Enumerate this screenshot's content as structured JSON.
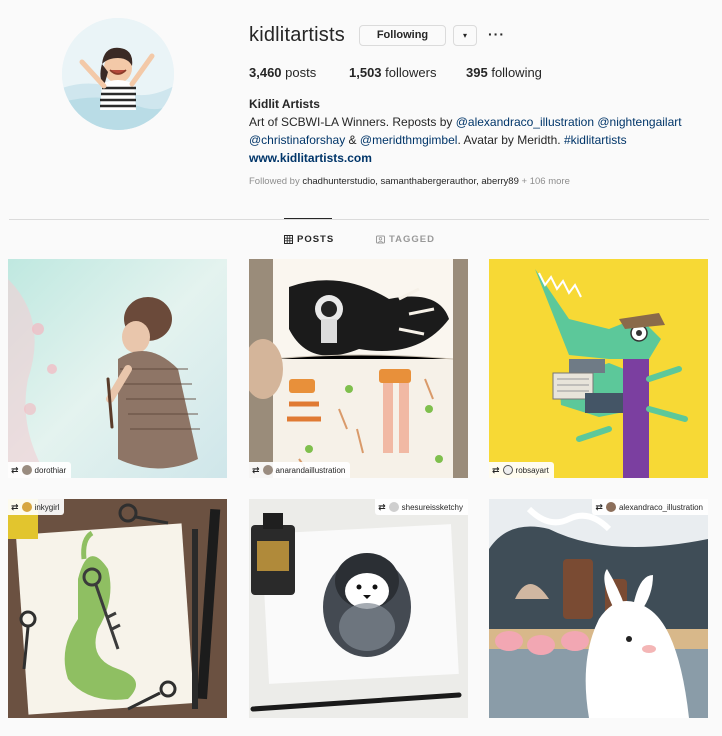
{
  "profile": {
    "username": "kidlitartists",
    "follow_label": "Following",
    "dropdown_glyph": "▾",
    "more_glyph": "···",
    "stats": {
      "posts_count": "3,460",
      "posts_label": "posts",
      "followers_count": "1,503",
      "followers_label": "followers",
      "following_count": "395",
      "following_label": "following"
    },
    "bio": {
      "name": "Kidlit Artists",
      "text_1": "Art of SCBWI-LA Winners. Reposts by ",
      "mention_1": "@alexandraco_illustration",
      "mention_2": "@nightengailart",
      "mention_3": "@christinaforshay",
      "text_2": " & ",
      "mention_4": "@meridthmgimbel",
      "text_3": ". Avatar by Meridth. ",
      "hashtag": "#kidlitartists",
      "website": "www.kidlitartists.com"
    },
    "followed_by": {
      "prefix": "Followed by ",
      "names": "chadhunterstudio, samanthabergerauthor, aberry89",
      "more": " + 106 more"
    }
  },
  "tabs": {
    "posts": "POSTS",
    "tagged": "TAGGED"
  },
  "posts": [
    {
      "author": "dorothiar"
    },
    {
      "author": "anarandaillustration"
    },
    {
      "author": "robsayart"
    },
    {
      "author": "inkygirl"
    },
    {
      "author": "shesureissketchy"
    },
    {
      "author": "alexandraco_illustration"
    }
  ],
  "icons": {
    "repost": "repost-icon",
    "grid": "grid-icon",
    "tag": "tag-icon"
  }
}
